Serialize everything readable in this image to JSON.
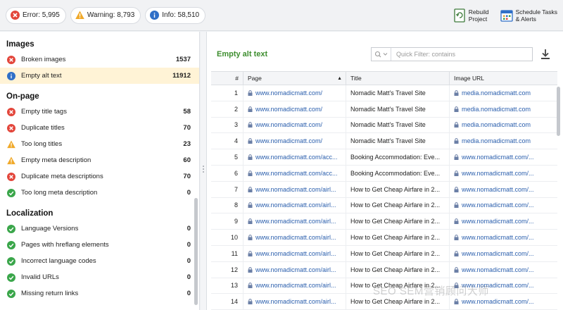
{
  "topbar": {
    "error_label": "Error: 5,995",
    "warning_label": "Warning: 8,793",
    "info_label": "Info: 58,510",
    "rebuild": [
      "Rebuild",
      "Project"
    ],
    "schedule": [
      "Schedule Tasks",
      "& Alerts"
    ]
  },
  "colors": {
    "error": "#e3463b",
    "warning": "#f0a92a",
    "info": "#2f6fc7",
    "ok": "#3aa64a",
    "accent_green": "#3d8d2e",
    "link": "#2b5fad",
    "selected_row": "#fff3d6"
  },
  "sidebar": {
    "sections": [
      {
        "title": "Images",
        "items": [
          {
            "icon": "error-icon",
            "label": "Broken images",
            "count": "1537"
          },
          {
            "icon": "info-icon",
            "label": "Empty alt text",
            "count": "11912",
            "selected": true
          }
        ]
      },
      {
        "title": "On-page",
        "items": [
          {
            "icon": "error-icon",
            "label": "Empty title tags",
            "count": "58"
          },
          {
            "icon": "error-icon",
            "label": "Duplicate titles",
            "count": "70"
          },
          {
            "icon": "warning-icon",
            "label": "Too long titles",
            "count": "23"
          },
          {
            "icon": "warning-icon",
            "label": "Empty meta description",
            "count": "60"
          },
          {
            "icon": "error-icon",
            "label": "Duplicate meta descriptions",
            "count": "70"
          },
          {
            "icon": "ok-icon",
            "label": "Too long meta description",
            "count": "0"
          }
        ]
      },
      {
        "title": "Localization",
        "items": [
          {
            "icon": "ok-icon",
            "label": "Language Versions",
            "count": "0"
          },
          {
            "icon": "ok-icon",
            "label": "Pages with hreflang elements",
            "count": "0"
          },
          {
            "icon": "ok-icon",
            "label": "Incorrect language codes",
            "count": "0"
          },
          {
            "icon": "ok-icon",
            "label": "Invalid URLs",
            "count": "0"
          },
          {
            "icon": "ok-icon",
            "label": "Missing return links",
            "count": "0"
          }
        ]
      }
    ]
  },
  "panel": {
    "title": "Empty alt text",
    "filter_placeholder": "Quick Filter: contains",
    "columns": {
      "num": "#",
      "page": "Page",
      "title": "Title",
      "image_url": "Image URL"
    },
    "rows": [
      {
        "n": "1",
        "page": "www.nomadicmatt.com/",
        "title": "Nomadic Matt's Travel Site",
        "img": "media.nomadicmatt.com"
      },
      {
        "n": "2",
        "page": "www.nomadicmatt.com/",
        "title": "Nomadic Matt's Travel Site",
        "img": "media.nomadicmatt.com"
      },
      {
        "n": "3",
        "page": "www.nomadicmatt.com/",
        "title": "Nomadic Matt's Travel Site",
        "img": "media.nomadicmatt.com"
      },
      {
        "n": "4",
        "page": "www.nomadicmatt.com/",
        "title": "Nomadic Matt's Travel Site",
        "img": "media.nomadicmatt.com"
      },
      {
        "n": "5",
        "page": "www.nomadicmatt.com/acc...",
        "title": "Booking Accommodation: Eve...",
        "img": "www.nomadicmatt.com/..."
      },
      {
        "n": "6",
        "page": "www.nomadicmatt.com/acc...",
        "title": "Booking Accommodation: Eve...",
        "img": "www.nomadicmatt.com/..."
      },
      {
        "n": "7",
        "page": "www.nomadicmatt.com/airl...",
        "title": "How to Get Cheap Airfare in 2...",
        "img": "www.nomadicmatt.com/..."
      },
      {
        "n": "8",
        "page": "www.nomadicmatt.com/airl...",
        "title": "How to Get Cheap Airfare in 2...",
        "img": "www.nomadicmatt.com/..."
      },
      {
        "n": "9",
        "page": "www.nomadicmatt.com/airl...",
        "title": "How to Get Cheap Airfare in 2...",
        "img": "www.nomadicmatt.com/..."
      },
      {
        "n": "10",
        "page": "www.nomadicmatt.com/airl...",
        "title": "How to Get Cheap Airfare in 2...",
        "img": "www.nomadicmatt.com/..."
      },
      {
        "n": "11",
        "page": "www.nomadicmatt.com/airl...",
        "title": "How to Get Cheap Airfare in 2...",
        "img": "www.nomadicmatt.com/..."
      },
      {
        "n": "12",
        "page": "www.nomadicmatt.com/airl...",
        "title": "How to Get Cheap Airfare in 2...",
        "img": "www.nomadicmatt.com/..."
      },
      {
        "n": "13",
        "page": "www.nomadicmatt.com/airl...",
        "title": "How to Get Cheap Airfare in 2...",
        "img": "www.nomadicmatt.com/..."
      },
      {
        "n": "14",
        "page": "www.nomadicmatt.com/airl...",
        "title": "How to Get Cheap Airfare in 2...",
        "img": "www.nomadicmatt.com/..."
      }
    ]
  },
  "watermark": "SEO SEM营销顾问大师"
}
